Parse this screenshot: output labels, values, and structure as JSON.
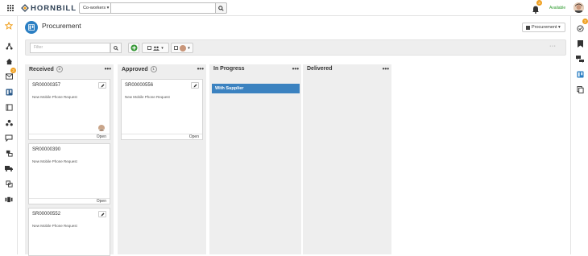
{
  "topbar": {
    "logo_text": "HORNBILL",
    "coworkers_label": "Co-workers ▾",
    "search_value": "",
    "notification_count": "3",
    "status": "Available"
  },
  "leftnav": {
    "icons": [
      "star-icon",
      "org-chart-icon",
      "home-icon",
      "inbox-icon",
      "board-icon",
      "book-icon",
      "network-icon",
      "chat-icon",
      "services-icon",
      "truck-icon",
      "transfer-icon",
      "org-icon"
    ],
    "inbox_badge": "3"
  },
  "rightnav": {
    "icons": [
      "check-circle-icon",
      "bookmark-icon",
      "chat-bubbles-icon",
      "board-icon",
      "documents-icon"
    ],
    "badge": "2"
  },
  "header": {
    "title": "Procurement",
    "view_label": "Procurement ▾"
  },
  "toolbar": {
    "filter_placeholder": "Filter",
    "more_label": "···"
  },
  "board": {
    "columns": [
      {
        "title": "Received",
        "count": "3"
      },
      {
        "title": "Approved",
        "count": "1"
      },
      {
        "title": "In Progress",
        "count": ""
      },
      {
        "title": "Delivered",
        "count": ""
      }
    ],
    "lane_label": "With Supplier",
    "col_menu": "•••",
    "cards": {
      "received": [
        {
          "id": "SR00000357",
          "desc": "New Mobile Phone Request",
          "status": "Open"
        },
        {
          "id": "SR00000390",
          "desc": "New Mobile Phone Request",
          "status": "Open"
        },
        {
          "id": "SR00000552",
          "desc": "New Mobile Phone Request",
          "status": ""
        }
      ],
      "approved": [
        {
          "id": "SR00000556",
          "desc": "New Mobile Phone Request",
          "status": "Open"
        }
      ]
    }
  },
  "colors": {
    "accent_blue": "#3b82c0",
    "badge_orange": "#f0a020",
    "available_green": "#2e9a2e"
  }
}
